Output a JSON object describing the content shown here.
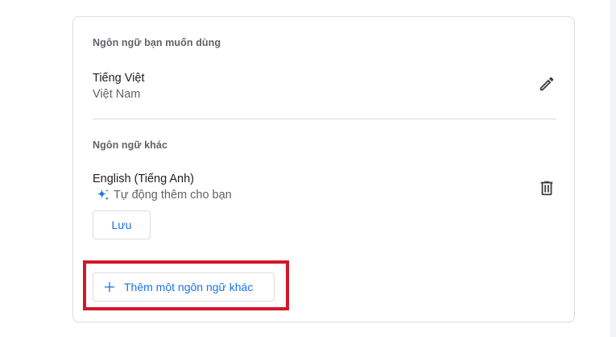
{
  "preferred_section": {
    "title": "Ngôn ngữ bạn muốn dùng",
    "language": "Tiếng Việt",
    "region": "Việt Nam",
    "edit_icon": "pencil-icon"
  },
  "other_section": {
    "title": "Ngôn ngữ khác",
    "language": "English (Tiếng Anh)",
    "auto_added_note": "Tự động thêm cho bạn",
    "auto_icon": "sparkle-icon",
    "delete_icon": "trash-icon",
    "save_label": "Lưu"
  },
  "add_language": {
    "label": "Thêm một ngôn ngữ khác",
    "icon": "plus-icon",
    "highlight_color": "#d3172a"
  },
  "colors": {
    "accent": "#1a73e8",
    "secondary_text": "#5f6368",
    "border": "#dadce0"
  }
}
